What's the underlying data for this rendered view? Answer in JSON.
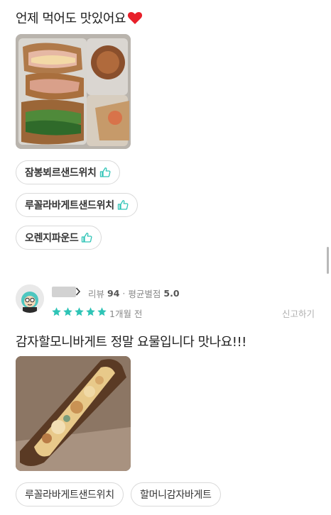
{
  "review1": {
    "text": "언제 먹어도 맛있어요",
    "emoji": "❤️",
    "tags": [
      {
        "label": "잠봉뵈르샌드위치",
        "liked": true
      },
      {
        "label": "루꼴라바게트샌드위치",
        "liked": true
      },
      {
        "label": "오렌지파운드",
        "liked": true
      }
    ]
  },
  "review2": {
    "review_count_label": "리뷰",
    "review_count": "94",
    "separator": "·",
    "avg_label": "평균별점",
    "avg_rating": "5.0",
    "stars": 5,
    "time": "1개월 전",
    "report_label": "신고하기",
    "text": "감자할모니바게트 정말 요물입니다 맛나요!!!",
    "tags": [
      {
        "label": "루꼴라바게트샌드위치",
        "liked": false
      },
      {
        "label": "할머니감자바게트",
        "liked": false
      }
    ]
  },
  "colors": {
    "star": "#2ec4b6",
    "thumb": "#2ec4b6",
    "heart": "#e8202a"
  },
  "icons": {
    "thumb": "thumbs-up-icon",
    "star": "star-icon",
    "heart": "heart-icon",
    "chevron": "chevron-right-icon"
  }
}
